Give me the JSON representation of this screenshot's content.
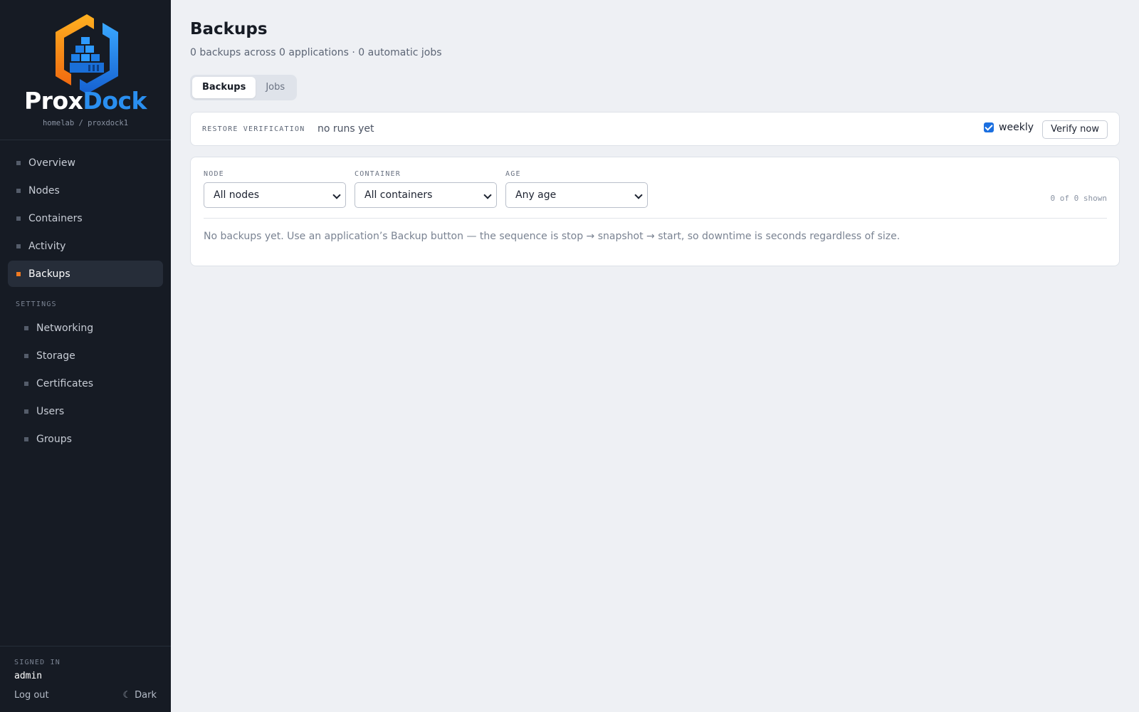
{
  "app": {
    "brand_prox": "Prox",
    "brand_dock": "Dock",
    "node_path": "homelab / proxdock1",
    "colors": {
      "accent": "#f07a21",
      "brand_blue": "#2a8ff0",
      "sidebar_bg": "#161b24",
      "checkbox": "#1b6fe0"
    }
  },
  "nav": {
    "items": [
      {
        "label": "Overview",
        "icon": "square-bullet-icon",
        "active": false
      },
      {
        "label": "Nodes",
        "icon": "square-bullet-icon",
        "active": false
      },
      {
        "label": "Containers",
        "icon": "square-bullet-icon",
        "active": false
      },
      {
        "label": "Activity",
        "icon": "square-bullet-icon",
        "active": false
      },
      {
        "label": "Backups",
        "icon": "square-bullet-icon",
        "active": true
      }
    ],
    "settings_label": "SETTINGS",
    "settings_items": [
      {
        "label": "Networking"
      },
      {
        "label": "Storage"
      },
      {
        "label": "Certificates"
      },
      {
        "label": "Users"
      },
      {
        "label": "Groups"
      }
    ]
  },
  "footer": {
    "signed_in_label": "SIGNED IN",
    "username": "admin",
    "logout_label": "Log out",
    "theme_icon": "moon-icon",
    "theme_label": "Dark"
  },
  "page": {
    "title": "Backups",
    "subtitle": "0 backups across 0 applications · 0 automatic jobs",
    "tabs": [
      {
        "label": "Backups",
        "active": true
      },
      {
        "label": "Jobs",
        "active": false
      }
    ]
  },
  "verification": {
    "label": "RESTORE VERIFICATION",
    "status": "no runs yet",
    "weekly_label": "weekly",
    "weekly_checked": true,
    "verify_button": "Verify now"
  },
  "filters": {
    "node_label": "NODE",
    "node_value": "All nodes",
    "container_label": "CONTAINER",
    "container_value": "All containers",
    "age_label": "AGE",
    "age_value": "Any age",
    "shown_text": "0 of 0 shown"
  },
  "empty_message": "No backups yet. Use an application’s Backup button — the sequence is stop → snapshot → start, so downtime is seconds regardless of size."
}
